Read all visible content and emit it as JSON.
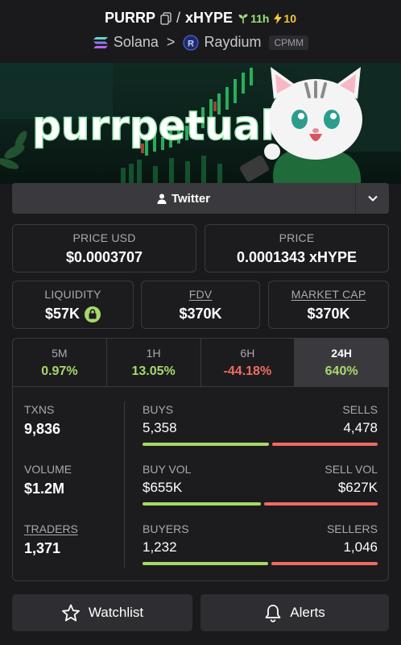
{
  "header": {
    "base_token": "PURRP",
    "separator": "/",
    "quote_token": "xHYPE",
    "age": "11h",
    "boosts": "10",
    "chain": "Solana",
    "chevron": ">",
    "dex": "Raydium",
    "pool_type": "CPMM"
  },
  "banner": {
    "logo_text": "purrpetual"
  },
  "social": {
    "twitter_label": "Twitter"
  },
  "price": {
    "usd_label": "PRICE USD",
    "usd_value": "$0.0003707",
    "native_label": "PRICE",
    "native_value": "0.0001343 xHYPE"
  },
  "stats": {
    "liquidity_label": "LIQUIDITY",
    "liquidity_value": "$57K",
    "fdv_label": "FDV",
    "fdv_value": "$370K",
    "mcap_label": "MARKET CAP",
    "mcap_value": "$370K"
  },
  "timeframes": [
    {
      "label": "5M",
      "value": "0.97%",
      "direction": "up"
    },
    {
      "label": "1H",
      "value": "13.05%",
      "direction": "up"
    },
    {
      "label": "6H",
      "value": "-44.18%",
      "direction": "down"
    },
    {
      "label": "24H",
      "value": "640%",
      "direction": "up",
      "active": true
    }
  ],
  "metrics": {
    "txns_label": "TXNS",
    "txns_value": "9,836",
    "buys_label": "BUYS",
    "buys_value": "5,358",
    "sells_label": "SELLS",
    "sells_value": "4,478",
    "buys_ratio": 0.545,
    "volume_label": "VOLUME",
    "volume_value": "$1.2M",
    "buy_vol_label": "BUY VOL",
    "buy_vol_value": "$655K",
    "sell_vol_label": "SELL VOL",
    "sell_vol_value": "$627K",
    "buy_vol_ratio": 0.511,
    "traders_label": "TRADERS",
    "traders_value": "1,371",
    "buyers_label": "BUYERS",
    "buyers_value": "1,232",
    "sellers_label": "SELLERS",
    "sellers_value": "1,046",
    "buyers_ratio": 0.541
  },
  "actions": {
    "watchlist_label": "Watchlist",
    "alerts_label": "Alerts"
  },
  "colors": {
    "positive": "#a6d96a",
    "negative": "#ef6b62",
    "background": "#1a1a1d"
  }
}
